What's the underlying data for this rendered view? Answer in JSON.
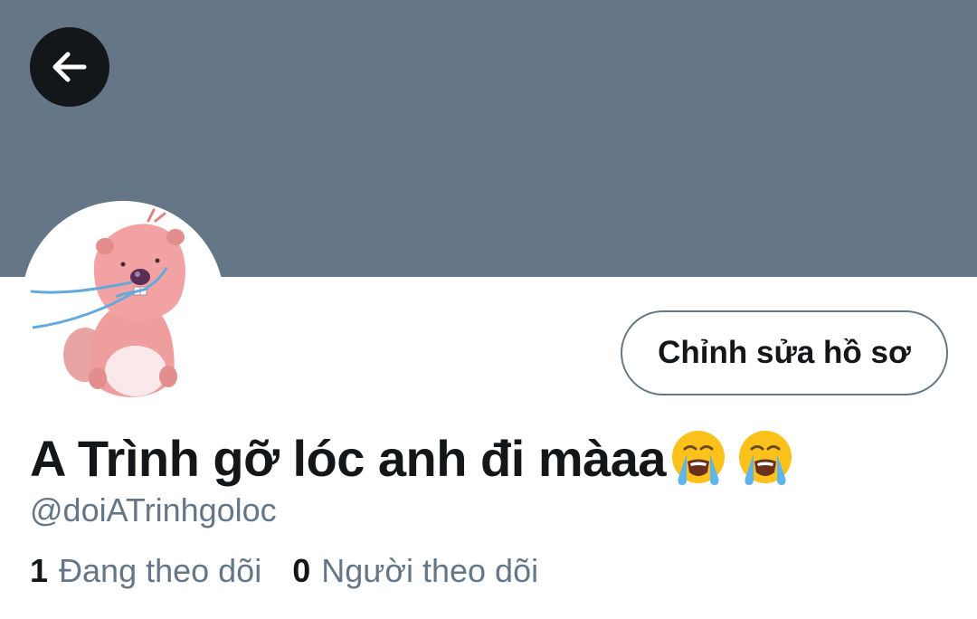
{
  "header": {
    "banner_color": "#657786",
    "back_icon": "arrow-left-icon"
  },
  "profile": {
    "avatar_icon": "beaver-crying-avatar",
    "edit_button_label": "Chỉnh sửa hồ sơ",
    "display_name": "A Trình gỡ lóc anh đi màaa",
    "name_emojis": [
      "loudly-crying-face",
      "loudly-crying-face"
    ],
    "handle": "@doiATrinhgoloc"
  },
  "stats": {
    "following_count": "1",
    "following_label": "Đang theo dõi",
    "followers_count": "0",
    "followers_label": "Người theo dõi"
  },
  "colors": {
    "text_primary": "#14171a",
    "text_secondary": "#657786",
    "background": "#ffffff"
  }
}
